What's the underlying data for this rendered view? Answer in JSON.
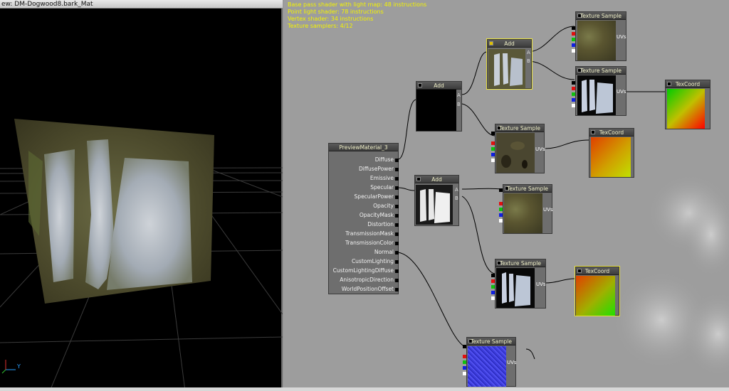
{
  "viewport": {
    "title": "ew: DM-Dogwood8.bark_Mat",
    "axis_y": "Y"
  },
  "stats": [
    "Base pass shader with light map: 48 instructions",
    "Point light shader: 78 instructions",
    "Vertex shader: 34 instructions",
    "Texture samplers: 4/12"
  ],
  "nodes": {
    "material": {
      "title": "PreviewMaterial_3",
      "inputs": [
        "Diffuse",
        "DiffusePower",
        "Emissive",
        "Specular",
        "SpecularPower",
        "Opacity",
        "OpacityMask",
        "Distortion",
        "TransmissionMask",
        "TransmissionColor",
        "Normal",
        "CustomLighting",
        "CustomLightingDiffuse",
        "AnisotropicDirection",
        "WorldPositionOffset"
      ]
    },
    "add_1": {
      "title": "Add",
      "in_a": "A",
      "in_b": "B"
    },
    "add_2": {
      "title": "Add",
      "in_a": "A",
      "in_b": "B"
    },
    "add_3": {
      "title": "Add",
      "in_a": "A",
      "in_b": "B"
    },
    "tex_1": {
      "title": "Texture Sample",
      "uv": "UVs"
    },
    "tex_2": {
      "title": "Texture Sample",
      "uv": "UVs"
    },
    "tex_3": {
      "title": "Texture Sample",
      "uv": "UVs"
    },
    "tex_4": {
      "title": "Texture Sample",
      "uv": "UVs"
    },
    "tex_5": {
      "title": "Texture Sample",
      "uv": "UVs"
    },
    "tex_6": {
      "title": "Texture Sample",
      "uv": "UVs"
    },
    "coord_1": {
      "title": "TexCoord"
    },
    "coord_2": {
      "title": "TexCoord"
    },
    "coord_3": {
      "title": "TexCoord"
    }
  },
  "colors": {
    "stats_text": "#f4f400",
    "pin_red": "#e01010",
    "pin_green": "#10c010",
    "pin_blue": "#1020e0",
    "pin_white": "#ffffff"
  }
}
